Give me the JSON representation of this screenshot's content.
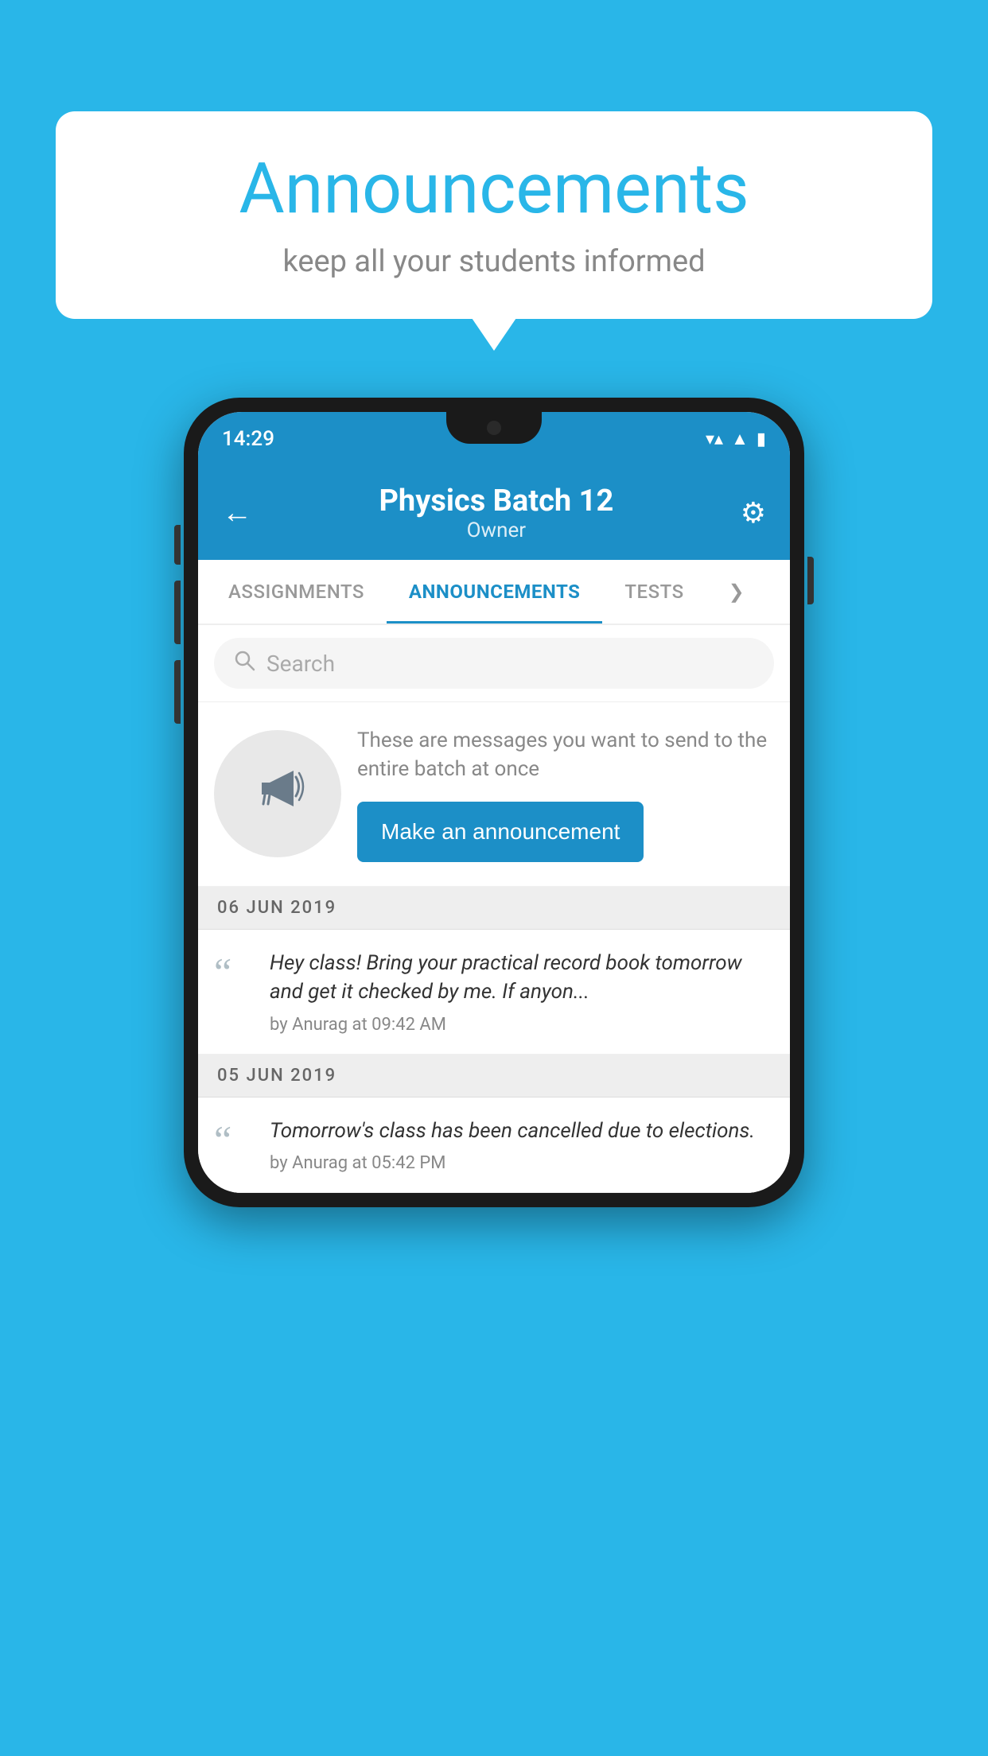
{
  "bubble": {
    "title": "Announcements",
    "subtitle": "keep all your students informed"
  },
  "status_bar": {
    "time": "14:29"
  },
  "header": {
    "title": "Physics Batch 12",
    "subtitle": "Owner"
  },
  "tabs": [
    {
      "label": "ASSIGNMENTS",
      "active": false
    },
    {
      "label": "ANNOUNCEMENTS",
      "active": true
    },
    {
      "label": "TESTS",
      "active": false
    },
    {
      "label": "...",
      "active": false
    }
  ],
  "search": {
    "placeholder": "Search"
  },
  "promo": {
    "description": "These are messages you want to send to the entire batch at once",
    "button_label": "Make an announcement"
  },
  "announcements": [
    {
      "date": "06  JUN  2019",
      "text": "Hey class! Bring your practical record book tomorrow and get it checked by me. If anyon...",
      "meta": "by Anurag at 09:42 AM"
    },
    {
      "date": "05  JUN  2019",
      "text": "Tomorrow's class has been cancelled due to elections.",
      "meta": "by Anurag at 05:42 PM"
    }
  ],
  "colors": {
    "primary": "#1c8fc7",
    "background": "#29b6e8",
    "white": "#ffffff",
    "gray_text": "#888888",
    "dark_text": "#333333"
  }
}
